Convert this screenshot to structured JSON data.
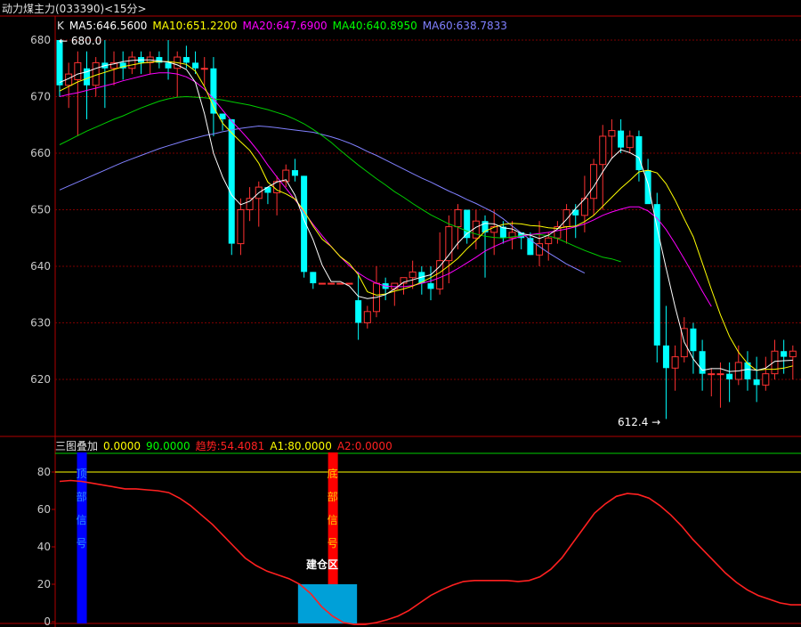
{
  "header": {
    "title": "动力煤主力(033390)<15分>"
  },
  "main_legend": [
    {
      "text": "K",
      "color": "#e0e0e0"
    },
    {
      "text": "MA5:646.5600",
      "color": "#ffffff"
    },
    {
      "text": "MA10:651.2200",
      "color": "#ffff00"
    },
    {
      "text": "MA20:647.6900",
      "color": "#ff00ff"
    },
    {
      "text": "MA40:640.8950",
      "color": "#00ff00"
    },
    {
      "text": "MA60:638.7833",
      "color": "#8080ff"
    }
  ],
  "sub_legend": [
    {
      "text": "三图叠加",
      "color": "#e0e0e0"
    },
    {
      "text": "0.0000",
      "color": "#ffff00"
    },
    {
      "text": "90.0000",
      "color": "#00ff00"
    },
    {
      "text": "趋势:54.4081",
      "color": "#ff2020"
    },
    {
      "text": "A1:80.0000",
      "color": "#ffff00"
    },
    {
      "text": "A2:0.0000",
      "color": "#ff2020"
    }
  ],
  "chart_data": [
    {
      "type": "candlestick",
      "ylim": [
        610,
        682
      ],
      "yticks": [
        620,
        630,
        640,
        650,
        660,
        670,
        680
      ],
      "grid": true,
      "high_label": "680.0",
      "low_label": "612.4",
      "colors": {
        "up": "#ff3232",
        "down": "#00ffff",
        "ma5": "#ffffff",
        "ma10": "#ffff00",
        "ma20": "#ff00ff",
        "ma40": "#00cc00",
        "ma60": "#8080ff"
      },
      "candles": [
        [
          680,
          680,
          670,
          672
        ],
        [
          672,
          676,
          668,
          674
        ],
        [
          673,
          678,
          663,
          676
        ],
        [
          675,
          678,
          666,
          672
        ],
        [
          672,
          677,
          670,
          676
        ],
        [
          676,
          680,
          668,
          675
        ],
        [
          675,
          678,
          672,
          676
        ],
        [
          676,
          678,
          673,
          675
        ],
        [
          675,
          678,
          674,
          677
        ],
        [
          677,
          678,
          674,
          676
        ],
        [
          676,
          678,
          674,
          677
        ],
        [
          677,
          678,
          675,
          676
        ],
        [
          676,
          680,
          673,
          675
        ],
        [
          675,
          678,
          670,
          677
        ],
        [
          677,
          679,
          675,
          676
        ],
        [
          676,
          678,
          674,
          675
        ],
        [
          675,
          677,
          672,
          675
        ],
        [
          675,
          677,
          663,
          667
        ],
        [
          667,
          667,
          664,
          666
        ],
        [
          666,
          666,
          642,
          644
        ],
        [
          644,
          652,
          642,
          650
        ],
        [
          650,
          654,
          648,
          652
        ],
        [
          652,
          655,
          647,
          654
        ],
        [
          654,
          654,
          651,
          653
        ],
        [
          653,
          656,
          649,
          655
        ],
        [
          655,
          658,
          654,
          657
        ],
        [
          657,
          659,
          655,
          656
        ],
        [
          656,
          656,
          638,
          639
        ],
        [
          639,
          639,
          636,
          637
        ],
        [
          637,
          637,
          637,
          637
        ],
        [
          637,
          637,
          637,
          637
        ],
        [
          637,
          637,
          637,
          637
        ],
        [
          637,
          637,
          637,
          637
        ],
        [
          634,
          639,
          627,
          630
        ],
        [
          630,
          633,
          629,
          632
        ],
        [
          632,
          640,
          631,
          637
        ],
        [
          637,
          638,
          634,
          636
        ],
        [
          636,
          637,
          633,
          637
        ],
        [
          637,
          638,
          635,
          638
        ],
        [
          638,
          641,
          636,
          639
        ],
        [
          639,
          640,
          635,
          637
        ],
        [
          637,
          640,
          634,
          636
        ],
        [
          636,
          646,
          635,
          641
        ],
        [
          641,
          649,
          637,
          647
        ],
        [
          647,
          651,
          643,
          650
        ],
        [
          650,
          650,
          644,
          645
        ],
        [
          645,
          650,
          643,
          648
        ],
        [
          648,
          649,
          638,
          646
        ],
        [
          646,
          650,
          642,
          647
        ],
        [
          647,
          648,
          644,
          645
        ],
        [
          645,
          648,
          643,
          646
        ],
        [
          646,
          646,
          643,
          645
        ],
        [
          645,
          646,
          642,
          642
        ],
        [
          642,
          648,
          640,
          644
        ],
        [
          644,
          646,
          641,
          645
        ],
        [
          645,
          648,
          644,
          647
        ],
        [
          647,
          651,
          644,
          650
        ],
        [
          650,
          651,
          645,
          649
        ],
        [
          649,
          656,
          646,
          652
        ],
        [
          652,
          659,
          649,
          658
        ],
        [
          658,
          665,
          650,
          663
        ],
        [
          663,
          666,
          659,
          664
        ],
        [
          664,
          666,
          660,
          661
        ],
        [
          661,
          664,
          660,
          663
        ],
        [
          663,
          664,
          655,
          657
        ],
        [
          657,
          659,
          652,
          651
        ],
        [
          651,
          653,
          623,
          626
        ],
        [
          626,
          633,
          613,
          622
        ],
        [
          622,
          626,
          618,
          624
        ],
        [
          624,
          631,
          623,
          629
        ],
        [
          629,
          630,
          621,
          625
        ],
        [
          625,
          627,
          618,
          621
        ],
        [
          621,
          622,
          617,
          621
        ],
        [
          621,
          623,
          615,
          621
        ],
        [
          621,
          623,
          616,
          620
        ],
        [
          620,
          626,
          619,
          623
        ],
        [
          623,
          625,
          618,
          620
        ],
        [
          620,
          624,
          616,
          619
        ],
        [
          619,
          624,
          618,
          621
        ],
        [
          621,
          627,
          620,
          625
        ],
        [
          625,
          627,
          621,
          624
        ],
        [
          624,
          626,
          620,
          625
        ]
      ],
      "ma5": [
        672.5,
        673.2,
        674,
        674.4,
        675,
        675.5,
        675.8,
        676.2,
        676.4,
        676.5,
        676.5,
        676.3,
        676.1,
        675.6,
        674.8,
        672.5,
        667,
        660,
        655.8,
        652.6,
        650.9,
        651.5,
        653,
        654,
        654.9,
        655.3,
        652.6,
        648.2,
        644.7,
        640.2,
        637.3,
        637.3,
        636.5,
        634.7,
        634.3,
        634.5,
        635,
        636,
        637.2,
        637.6,
        638.1,
        638.5,
        640,
        642,
        644.1,
        645.8,
        646.9,
        647.6,
        647.5,
        646.8,
        646.6,
        645.8,
        645.5,
        644.9,
        645.5,
        646.6,
        648.3,
        650.2,
        651.9,
        654.1,
        656.7,
        659.1,
        660.6,
        660.1,
        659.2,
        654.6,
        646.8,
        639.7,
        632.8,
        626.6,
        623.6,
        621.6,
        621.9,
        621.9,
        621.4,
        621.5,
        621.8,
        621.6,
        622,
        623.2,
        623.3,
        623.4
      ],
      "ma10": [
        671,
        671.8,
        672.6,
        673.2,
        673.8,
        674.3,
        674.8,
        675.3,
        675.6,
        675.9,
        676.1,
        676.2,
        676.2,
        676,
        675.7,
        674.5,
        671.8,
        668.2,
        665.3,
        663.6,
        662,
        660.5,
        658.2,
        654.9,
        653.5,
        652.8,
        651.9,
        649.8,
        647.1,
        644.8,
        643.5,
        641.7,
        640.5,
        638.5,
        635.5,
        634.9,
        635.1,
        635.6,
        636,
        636.5,
        637.2,
        638,
        638.9,
        640.1,
        641.4,
        643.1,
        644.6,
        646.2,
        646.9,
        647.4,
        647.6,
        647.5,
        647.2,
        647.1,
        646.8,
        646.7,
        647,
        647.1,
        647.9,
        649,
        650.6,
        652.2,
        653.8,
        655.2,
        656.7,
        657,
        656.5,
        654.6,
        651.7,
        648.4,
        645.2,
        640.6,
        635.9,
        631.4,
        627.6,
        624.8,
        622.8,
        621.6,
        621.8,
        621.8,
        622,
        622.4
      ],
      "ma20": [
        670,
        670.4,
        670.7,
        671.1,
        671.5,
        671.9,
        672.3,
        672.8,
        673.2,
        673.6,
        674,
        674.2,
        674.2,
        674,
        673.5,
        672.6,
        671.3,
        669.6,
        667.6,
        665.7,
        664,
        662.2,
        660.2,
        657.9,
        655.8,
        653.8,
        651.8,
        649.6,
        647.4,
        645.4,
        643.5,
        641.7,
        640.1,
        638.8,
        637.8,
        637,
        636.5,
        636.4,
        636.4,
        636.6,
        637,
        637.4,
        638,
        638.7,
        639.6,
        640.6,
        641.6,
        642.7,
        643.5,
        644.2,
        644.8,
        645.3,
        645.6,
        645.8,
        646,
        646.3,
        646.6,
        647,
        647.5,
        648.2,
        649,
        649.6,
        650.1,
        650.5,
        650.5,
        649.8,
        648.5,
        646.5,
        644,
        641.3,
        638.5,
        635.6,
        632.9
      ],
      "ma40": [
        661.5,
        662.3,
        663.1,
        663.9,
        664.6,
        665.3,
        666,
        666.6,
        667.3,
        668,
        668.6,
        669.2,
        669.6,
        669.9,
        670,
        669.9,
        669.8,
        669.6,
        669.4,
        669.1,
        668.8,
        668.5,
        668.1,
        667.7,
        667.2,
        666.7,
        666,
        665.2,
        664.2,
        663.1,
        661.9,
        660.5,
        659.2,
        657.9,
        656.7,
        655.5,
        654.4,
        653.2,
        652.2,
        651.1,
        650.1,
        649.1,
        648.3,
        647.5,
        646.9,
        646.2,
        645.7,
        645.3,
        645.1,
        645,
        645.2,
        645.4,
        645.6,
        645.6,
        645.4,
        644.9,
        644.2,
        643.5,
        642.8,
        642.2,
        641.6,
        641.3,
        640.8
      ],
      "ma60": [
        653.5,
        654.2,
        654.9,
        655.6,
        656.3,
        657,
        657.7,
        658.4,
        659,
        659.6,
        660.2,
        660.8,
        661.3,
        661.8,
        662.3,
        662.7,
        663.1,
        663.4,
        663.8,
        664.1,
        664.4,
        664.6,
        664.8,
        664.7,
        664.5,
        664.3,
        664.1,
        663.9,
        663.7,
        663.3,
        662.9,
        662.4,
        661.8,
        661.1,
        660.3,
        659.6,
        658.8,
        658,
        657.2,
        656.4,
        655.6,
        654.9,
        654.1,
        653.3,
        652.6,
        651.8,
        651.1,
        650.3,
        649.5,
        648.4,
        647.1,
        645.9,
        644.7,
        643.5,
        642.4,
        641.4,
        640.4,
        639.6,
        638.8
      ]
    },
    {
      "type": "line",
      "ylim": [
        -2,
        92
      ],
      "yticks": [
        0,
        20,
        40,
        60,
        80
      ],
      "hlines": [
        {
          "value": 90,
          "color": "#00cc00"
        },
        {
          "value": 80,
          "color": "#ffff00"
        }
      ],
      "series": [
        {
          "name": "趋势",
          "color": "#ff2020",
          "values": [
            75,
            75.5,
            75,
            74,
            73,
            72,
            71,
            71,
            70.5,
            70,
            69,
            66,
            62,
            57,
            52,
            46,
            40,
            34,
            30,
            27,
            25,
            23,
            20,
            15,
            8,
            3,
            -0.5,
            -1.5,
            -1.5,
            -0.5,
            1,
            3,
            6,
            10,
            14,
            17,
            19.5,
            21.5,
            22,
            22,
            22,
            22,
            21.5,
            22,
            24,
            28,
            34,
            42,
            50,
            58,
            63,
            67,
            68.5,
            68,
            66,
            62,
            57,
            51,
            44,
            38,
            32,
            26,
            21,
            17,
            14,
            12,
            10,
            9,
            9
          ]
        }
      ],
      "signals": [
        {
          "label": "顶部信号",
          "color": "#0000ff",
          "text_color": "#2a8cff",
          "index": 2
        },
        {
          "label": "底部信号",
          "color": "#ff0000",
          "text_color": "#ffc800",
          "index": 25
        }
      ],
      "zone": {
        "label": "建仓区",
        "color": "#00a0d8",
        "start": 22,
        "end": 27,
        "top": 20
      }
    }
  ]
}
